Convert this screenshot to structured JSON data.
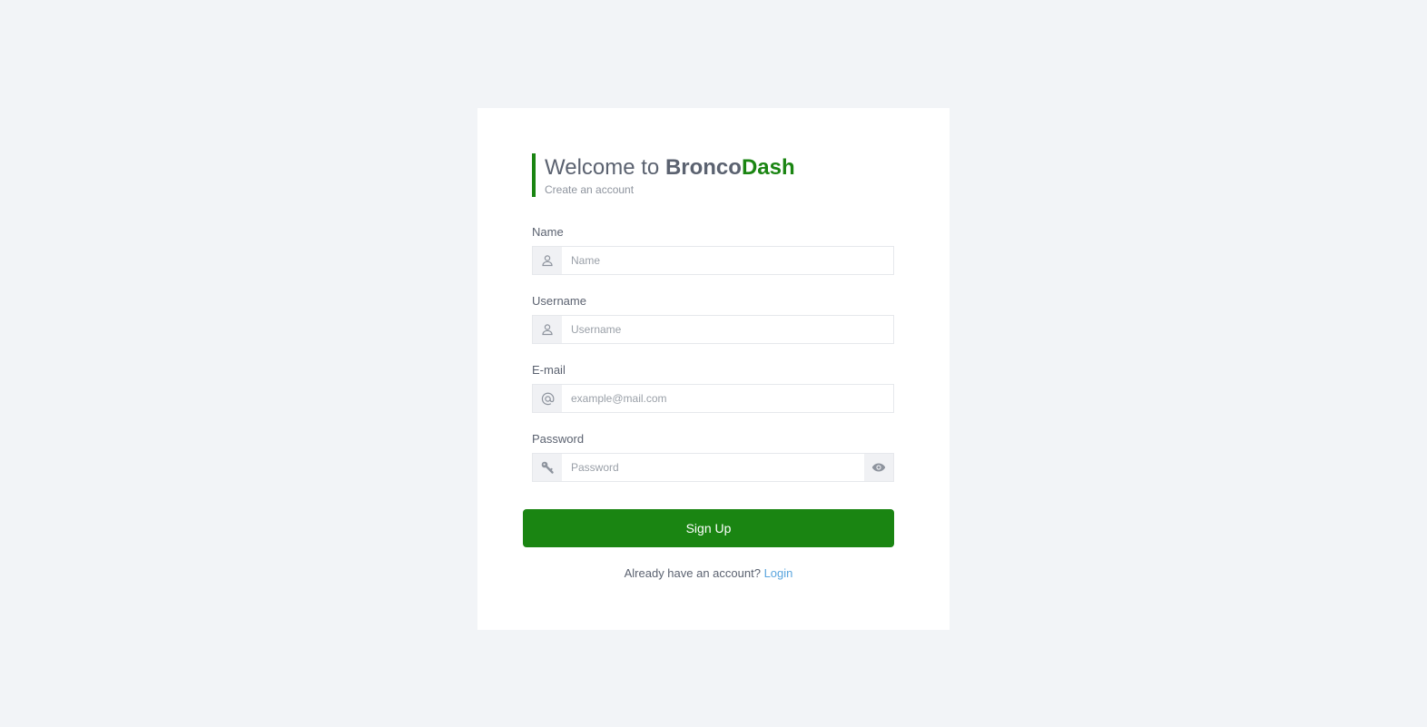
{
  "header": {
    "title_prefix": "Welcome to ",
    "brand_part1": "Bronco",
    "brand_part2": "Dash",
    "subtitle": "Create an account"
  },
  "form": {
    "name": {
      "label": "Name",
      "placeholder": "Name",
      "icon": "user-icon"
    },
    "username": {
      "label": "Username",
      "placeholder": "Username",
      "icon": "user-icon"
    },
    "email": {
      "label": "E-mail",
      "placeholder": "example@mail.com",
      "icon": "at-icon"
    },
    "password": {
      "label": "Password",
      "placeholder": "Password",
      "icon": "key-icon",
      "toggle_icon": "eye-icon"
    },
    "submit_label": "Sign Up"
  },
  "footer": {
    "prompt": "Already have an account?",
    "login_link": "Login"
  },
  "colors": {
    "brand_green": "#1a8512",
    "link_blue": "#5aa5de",
    "page_bg": "#f2f4f7",
    "text_gray": "#5b6270"
  }
}
